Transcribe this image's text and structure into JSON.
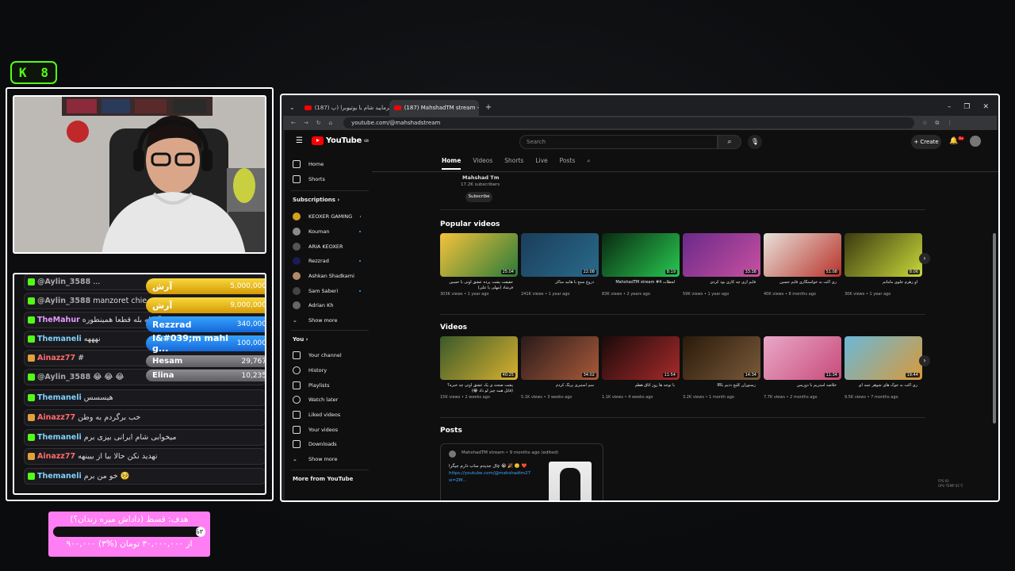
{
  "kick_badge": {
    "k": "K",
    "count": "8"
  },
  "chat": {
    "messages": [
      {
        "badge": "kick",
        "user": "@Aylin_3588",
        "text": "...",
        "color": "#aaaaaa"
      },
      {
        "badge": "kick",
        "user": "@Aylin_3588",
        "text": "manzoret chie",
        "color": "#aaaaaa"
      },
      {
        "badge": "kick",
        "user": "TheMahur",
        "text": "بله بله قطعا همینطوره 😂",
        "color": "#e59bff"
      },
      {
        "badge": "kick",
        "user": "Themaneli",
        "text": "نهههه",
        "color": "#7fd3ff"
      },
      {
        "badge": "vip",
        "user": "Ainazz77",
        "text": "#",
        "color": "#ff6b6b"
      },
      {
        "badge": "kick",
        "user": "@Aylin_3588",
        "text": "😂 😂 😂",
        "color": "#aaaaaa"
      },
      {
        "badge": "kick",
        "user": "Themaneli",
        "text": "هیسسس",
        "color": "#7fd3ff"
      },
      {
        "badge": "vip",
        "user": "Ainazz77",
        "text": "خب برگردم به وطن",
        "color": "#ff6b6b"
      },
      {
        "badge": "kick",
        "user": "Themaneli",
        "text": "میخوابی شام ایرانی بپزی برم",
        "color": "#7fd3ff"
      },
      {
        "badge": "vip",
        "user": "Ainazz77",
        "text": "تهدید نکن حالا بیا از بیینهه",
        "color": "#ff6b6b"
      },
      {
        "badge": "kick",
        "user": "Themaneli",
        "text": "خو من برم 🥺",
        "color": "#7fd3ff"
      }
    ],
    "donations": [
      {
        "name": "آرش",
        "amount": "5,000,000",
        "style": "gold"
      },
      {
        "name": "آرش",
        "amount": "9,000,000",
        "style": "gold"
      },
      {
        "name": "Rezzrad",
        "amount": "340,000",
        "style": "blue"
      },
      {
        "name": "I&#039;m mahi g...",
        "amount": "100,000",
        "style": "blue"
      },
      {
        "name": "Hesam",
        "amount": "29,767",
        "style": "grey"
      },
      {
        "name": "Elina",
        "amount": "10,235",
        "style": "grey"
      }
    ]
  },
  "goal": {
    "title": "هدف: قسط (داداش میره زندان؟)",
    "percent_label": "%۳",
    "progress": 0.03,
    "amount_text": "۹۰۰,۰۰۰ از ۳۰,۰۰۰,۰۰۰ تومان (%۳)"
  },
  "browser": {
    "tabs": [
      {
        "title": "(187) بفرمایید شام با یوتیوبرا (پ...",
        "active": false
      },
      {
        "title": "(187) MahshadTM stream - Yo...",
        "active": true
      }
    ],
    "url": "youtube.com/@mahshadstream",
    "window_controls": {
      "min": "–",
      "max": "❐",
      "close": "✕"
    }
  },
  "youtube": {
    "logo": "YouTube",
    "logo_sup": "GB",
    "search_placeholder": "Search",
    "create_label": "+ Create",
    "notif_count": "9+",
    "channel_tabs": [
      "Home",
      "Videos",
      "Shorts",
      "Live",
      "Posts"
    ],
    "channel_name": "Mahshad Tm",
    "channel_subs": "17.2K subscribers",
    "subscribe_label": "Subscribe",
    "sidebar": {
      "top": [
        {
          "label": "Home",
          "icon": "home-icon"
        },
        {
          "label": "Shorts",
          "icon": "shorts-icon"
        }
      ],
      "subs_title": "Subscriptions ›",
      "subscriptions": [
        {
          "label": "KEOXER GAMING",
          "color": "#d4a21a",
          "dot": true
        },
        {
          "label": "Kouman",
          "color": "#8a8a8a",
          "dot": true
        },
        {
          "label": "ARIA KEOXER",
          "color": "#555555",
          "dot": false
        },
        {
          "label": "Rezzrad",
          "color": "#1b1b55",
          "dot": true
        },
        {
          "label": "Ashkan Shadkami",
          "color": "#b08a6a",
          "dot": true
        },
        {
          "label": "Sam Saberi",
          "color": "#444444",
          "dot": true
        },
        {
          "label": "Adrian Kh",
          "color": "#666666",
          "dot": false
        },
        {
          "label": "Show more",
          "color": "",
          "dot": false
        }
      ],
      "you_title": "You ›",
      "you_items": [
        {
          "label": "Your channel",
          "icon": "channel-icon"
        },
        {
          "label": "History",
          "icon": "history-icon"
        },
        {
          "label": "Playlists",
          "icon": "playlists-icon"
        },
        {
          "label": "Watch later",
          "icon": "watch-later-icon"
        },
        {
          "label": "Liked videos",
          "icon": "liked-icon"
        },
        {
          "label": "Your videos",
          "icon": "your-videos-icon"
        },
        {
          "label": "Downloads",
          "icon": "downloads-icon"
        },
        {
          "label": "Show more",
          "icon": "chevron-down-icon"
        }
      ],
      "more_title": "More from YouTube"
    },
    "popular_title": "Popular videos",
    "popular": [
      {
        "dur": "25:04",
        "title": "حقیقت پشت پرده عشق اوتی با حسین فرشاد (مهلی یا علی)",
        "meta": "303K views • 1 year ago",
        "c1": "#f5c33b",
        "c2": "#2a7a3a"
      },
      {
        "dur": "22:08",
        "title": "دروغ سنج با هانیه ساکر",
        "meta": "241K views • 1 year ago",
        "c1": "#1a3e5a",
        "c2": "#2a6a8a"
      },
      {
        "dur": "8:19",
        "title": "MahshadTM stream #4 لحظات",
        "meta": "83K views • 2 years ago",
        "c1": "#0a2a12",
        "c2": "#28c850"
      },
      {
        "dur": "33:38",
        "title": "فایم اری چه کاری بود کردی",
        "meta": "59K views • 1 year ago",
        "c1": "#6a2a8a",
        "c2": "#c850a0"
      },
      {
        "dur": "51:08",
        "title": "ری اکت به خواستگاری فایم حسین",
        "meta": "40K views • 8 months ago",
        "c1": "#e8e2da",
        "c2": "#b8322a"
      },
      {
        "dur": "8:06",
        "title": "آو زهرم جلوی مامانم",
        "meta": "30K views • 1 year ago",
        "c1": "#3a3a10",
        "c2": "#c8d83a"
      }
    ],
    "videos_title": "Videos",
    "videos": [
      {
        "dur": "40:25",
        "title": "پشت صحنه ی یک عشق اوتی چه خبره؟ (فایل همه چیز لو داد 😂)",
        "meta": "15K views • 2 weeks ago",
        "c1": "#3a5a2a",
        "c2": "#d8b030"
      },
      {
        "dur": "34:02",
        "title": "سم استیری پرنگ کردم",
        "meta": "5.1K views • 3 weeks ago",
        "c1": "#2a1a1a",
        "c2": "#a85a3a"
      },
      {
        "dur": "11:54",
        "title": "با توجه ها روز اتاق هطم",
        "meta": "1.1K views • 4 weeks ago",
        "c1": "#1a0a0a",
        "c2": "#a82a2a"
      },
      {
        "dur": "14:34",
        "title": "IRL رستوران کلیج ذدیم",
        "meta": "3.2K views • 1 month ago",
        "c1": "#2a1a0a",
        "c2": "#7a5a3a"
      },
      {
        "dur": "11:34",
        "title": "خلاصه استریم با دوریس",
        "meta": "7.7K views • 2 months ago",
        "c1": "#e8a8c8",
        "c2": "#c84a7a"
      },
      {
        "dur": "19:44",
        "title": "ری اکت به جوک های شوهر عمه ای",
        "meta": "9.5K views • 7 months ago",
        "c1": "#6ab8d8",
        "c2": "#d89a3a"
      }
    ],
    "posts_title": "Posts",
    "post": {
      "author": "MahshadTM stream • 9 months ago (edited)",
      "text": "چال جدیدم ساب دارم جیگرا 😭 🎉 🙂 ❤️",
      "link": "https://youtube.com/@mahshadtm27 si=ZM..."
    },
    "stats": [
      "FPS 60",
      "GPU TEMP 61°C"
    ]
  }
}
